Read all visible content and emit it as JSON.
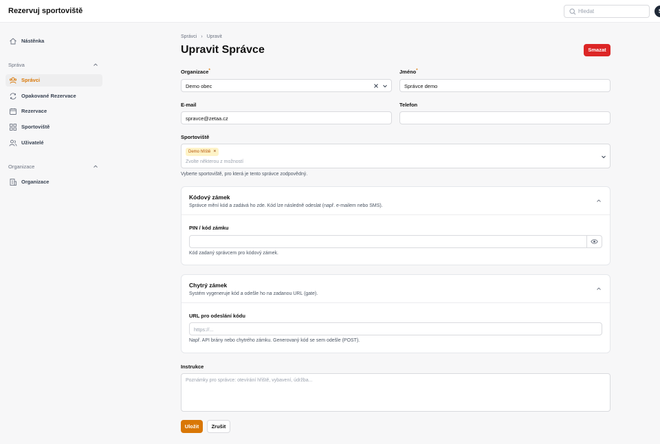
{
  "app": {
    "title": "Rezervuj sportoviště",
    "avatar_initial": "S"
  },
  "search": {
    "placeholder": "Hledat"
  },
  "sidebar": {
    "dashboard": "Nástěnka",
    "groups": [
      {
        "label": "Správa",
        "items": [
          "Správci",
          "Opakované Rezervace",
          "Rezervace",
          "Sportoviště",
          "Uživatelé"
        ]
      },
      {
        "label": "Organizace",
        "items": [
          "Organizace"
        ]
      }
    ],
    "active_item": "Správci"
  },
  "breadcrumb": [
    "Správci",
    "Upravit"
  ],
  "page": {
    "title": "Upravit Správce",
    "delete_label": "Smazat"
  },
  "form": {
    "organization": {
      "label": "Organizace",
      "value": "Demo obec"
    },
    "name": {
      "label": "Jméno",
      "value": "Správce demo"
    },
    "email": {
      "label": "E-mail",
      "value": "spravce@zetaa.cz"
    },
    "phone": {
      "label": "Telefon",
      "value": ""
    },
    "venues": {
      "label": "Sportoviště",
      "selected": [
        "Demo hřiště"
      ],
      "placeholder": "Zvolte některou z možností",
      "hint": "Vyberte sportoviště, pro která je tento správce zodpovědný."
    },
    "code_lock": {
      "title": "Kódový zámek",
      "description": "Správce mění kód a zadává ho zde. Kód lze následně odeslat (např. e-mailem nebo SMS).",
      "pin_label": "PIN / kód zámku",
      "pin_value": "",
      "pin_hint": "Kód zadaný správcem pro kódový zámek."
    },
    "smart_lock": {
      "title": "Chytrý zámek",
      "description": "Systém vygeneruje kód a odešle ho na zadanou URL (gate).",
      "url_label": "URL pro odeslání kódu",
      "url_placeholder": "https://...",
      "url_hint": "Např. API brány nebo chytrého zámku. Generovaný kód se sem odešle (POST)."
    },
    "instructions": {
      "label": "Instrukce",
      "placeholder": "Poznámky pro správce: otevírání hřiště, vybavení, údržba..."
    },
    "save_label": "Uložit",
    "cancel_label": "Zrušit"
  },
  "colors": {
    "accent": "#d97706",
    "danger": "#dc2626"
  }
}
